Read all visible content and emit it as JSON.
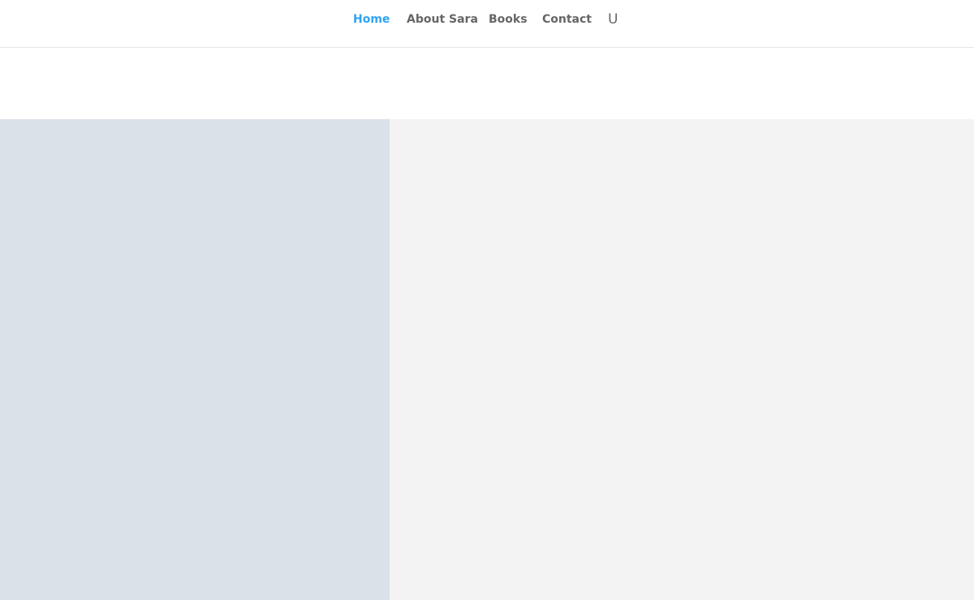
{
  "nav": {
    "items": [
      {
        "label": "Home",
        "active": true
      },
      {
        "label": "About Sara",
        "active": false
      },
      {
        "label": "Books",
        "active": false
      },
      {
        "label": "Contact",
        "active": false
      }
    ],
    "search_icon_glyph": "U",
    "search_icon": "search-icon"
  },
  "colors": {
    "accent": "#2ea3f2",
    "nav_text": "#666666",
    "left_panel": "#dbe1e9",
    "right_panel": "#f3f3f3"
  }
}
